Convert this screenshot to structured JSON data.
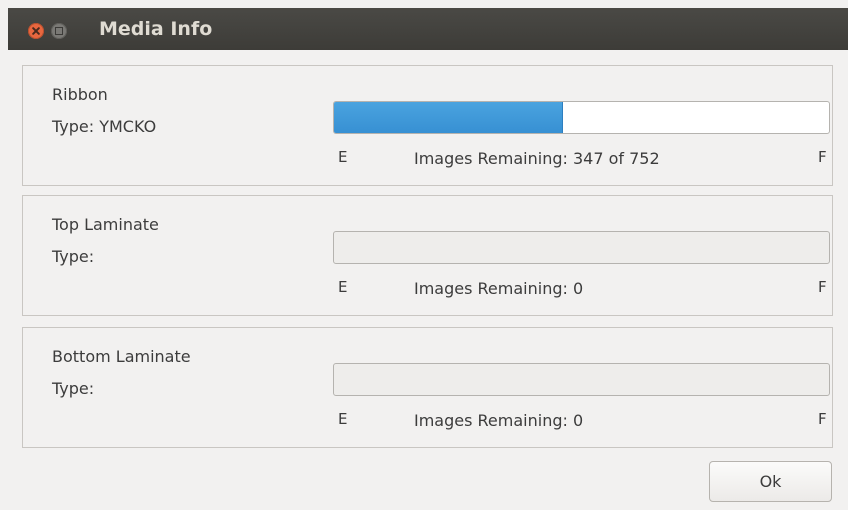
{
  "window": {
    "title": "Media Info"
  },
  "groups": [
    {
      "name": "Ribbon",
      "type_label": "Type: YMCKO",
      "empty_label": "E",
      "full_label": "F",
      "remaining_text": "Images Remaining: 347 of 752",
      "level_fraction": 0.461
    },
    {
      "name": "Top Laminate",
      "type_label": "Type:",
      "empty_label": "E",
      "full_label": "F",
      "remaining_text": "Images Remaining: 0",
      "level_fraction": 0
    },
    {
      "name": "Bottom Laminate",
      "type_label": "Type:",
      "empty_label": "E",
      "full_label": "F",
      "remaining_text": "Images Remaining: 0",
      "level_fraction": 0
    }
  ],
  "buttons": {
    "ok_label": "Ok"
  },
  "colors": {
    "progress_fill": "#3a93d6",
    "titlebar": "#42413d",
    "close_button": "#e8673f"
  }
}
